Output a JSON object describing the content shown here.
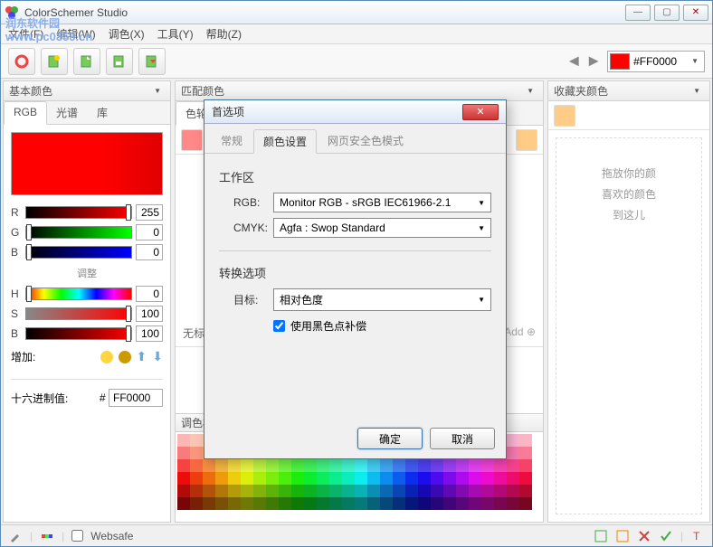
{
  "app": {
    "title": "ColorSchemer Studio"
  },
  "watermark": {
    "name": "润东软件园",
    "url": "www.pc0359.cn"
  },
  "menubar": [
    "文件(F)",
    "编辑(W)",
    "调色(X)",
    "工具(Y)",
    "帮助(Z)"
  ],
  "toolbar": {
    "hex_label": "#FF0000",
    "current_color": "#FF0000"
  },
  "panels": {
    "left": {
      "title": "基本颜色",
      "tabs": [
        "RGB",
        "光谱",
        "库"
      ],
      "active_tab": 0,
      "rgb": {
        "R": 255,
        "G": 0,
        "B": 0
      },
      "adjust_label": "调整",
      "hsb": {
        "H": 0,
        "S": 100,
        "B": 100
      },
      "increment_label": "增加:",
      "hex_label": "十六进制值:",
      "hex_prefix": "#",
      "hex_value": "FF0000"
    },
    "mid": {
      "title": "匹配颜色",
      "tab_wheel": "色轮",
      "untitled": "无标题",
      "add_label": "Add",
      "palette_title": "调色板"
    },
    "right": {
      "title": "收藏夹颜色",
      "placeholder": [
        "拖放你的颜",
        "喜欢的颜色",
        "到这儿"
      ]
    }
  },
  "statusbar": {
    "websafe": "Websafe"
  },
  "dialog": {
    "title": "首选项",
    "tabs": [
      "常规",
      "颜色设置",
      "网页安全色模式"
    ],
    "active_tab": 1,
    "workspace_title": "工作区",
    "rgb_label": "RGB:",
    "rgb_value": "Monitor RGB - sRGB IEC61966-2.1",
    "cmyk_label": "CMYK:",
    "cmyk_value": "Agfa : Swop Standard",
    "convert_title": "转换选项",
    "target_label": "目标:",
    "target_value": "相对色度",
    "blackpoint_label": "使用黑色点补偿",
    "blackpoint_checked": true,
    "ok": "确定",
    "cancel": "取消"
  }
}
